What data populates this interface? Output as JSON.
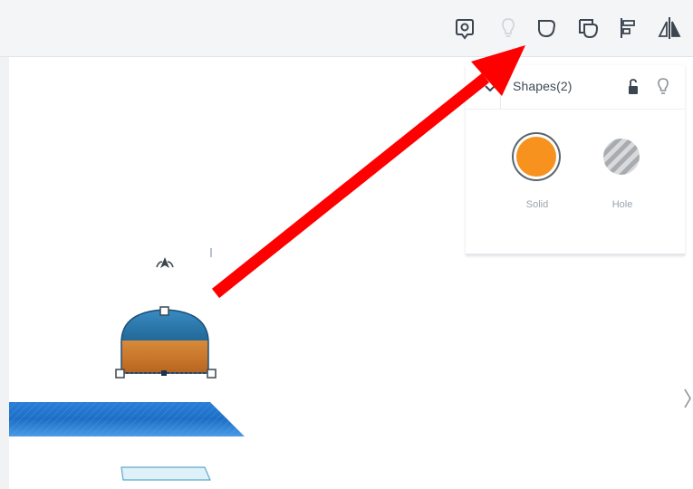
{
  "toolbar": {
    "tools": [
      {
        "icon": "note-pin-icon",
        "state": "enabled"
      },
      {
        "icon": "light-bulb-icon",
        "state": "disabled"
      },
      {
        "icon": "group-icon",
        "state": "enabled"
      },
      {
        "icon": "ungroup-icon",
        "state": "enabled"
      },
      {
        "icon": "align-icon",
        "state": "enabled"
      },
      {
        "icon": "mirror-icon",
        "state": "enabled"
      }
    ]
  },
  "inspector": {
    "title": "Shapes(2)",
    "icons": [
      "collapse-icon",
      "lock-icon",
      "light-bulb-icon"
    ],
    "materials": [
      {
        "label": "Solid",
        "color": "#f7921e",
        "selected": true
      },
      {
        "label": "Hole",
        "color": "#b0b4b8",
        "selected": false
      }
    ]
  },
  "annotation": {
    "type": "red-arrow",
    "color": "#ff0000",
    "points_to": "group-icon"
  },
  "workplane": {
    "color": "#1d6fc7"
  },
  "selected_shape": {
    "top_color": "#2c7ab0",
    "bottom_color": "#c8752a"
  }
}
